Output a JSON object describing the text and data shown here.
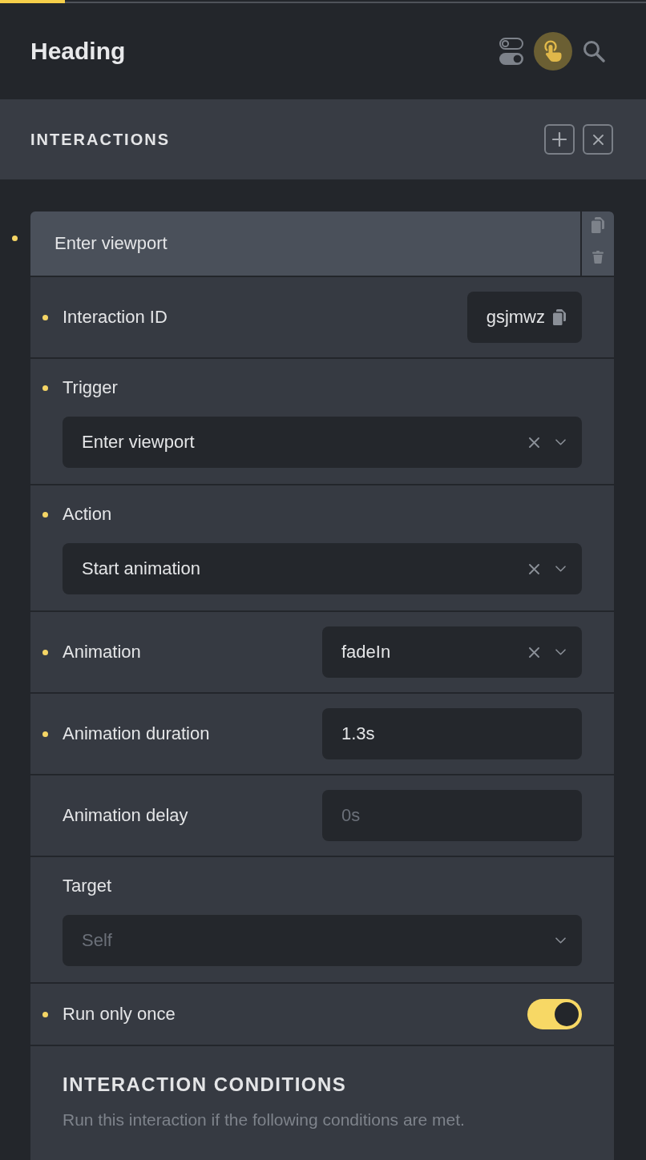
{
  "progress": {
    "level": 0.1
  },
  "header": {
    "title": "Heading",
    "tools": [
      {
        "kind": "toggles",
        "selected": false
      },
      {
        "kind": "pointer",
        "selected": true
      },
      {
        "kind": "search",
        "selected": false
      }
    ]
  },
  "interactions_bar": {
    "title": "INTERACTIONS",
    "buttons": [
      {
        "kind": "add"
      },
      {
        "kind": "close"
      }
    ]
  },
  "interaction": {
    "title": "Enter viewport",
    "modified": true,
    "actions": [
      {
        "kind": "copy"
      },
      {
        "kind": "delete"
      }
    ],
    "fields": [
      {
        "kind": "id",
        "label": "Interaction ID",
        "modified": true,
        "value": "gsjmwz"
      },
      {
        "kind": "dropdown",
        "label": "Trigger",
        "modified": true,
        "stacked": true,
        "value": "Enter viewport"
      },
      {
        "kind": "dropdown",
        "label": "Action",
        "modified": true,
        "stacked": true,
        "value": "Start animation"
      },
      {
        "kind": "dropdown",
        "label": "Animation",
        "modified": true,
        "stacked": false,
        "value": "fadeIn"
      },
      {
        "kind": "text",
        "label": "Animation duration",
        "modified": true,
        "value": "1.3s"
      },
      {
        "kind": "text",
        "label": "Animation delay",
        "modified": false,
        "placeholder": "0s"
      },
      {
        "kind": "dropdown",
        "label": "Target",
        "modified": false,
        "stacked": true,
        "placeholder": "Self"
      },
      {
        "kind": "toggle",
        "label": "Run only once",
        "modified": true,
        "on": true
      }
    ],
    "conditions": {
      "title": "INTERACTION CONDITIONS",
      "description": "Run this interaction if the following conditions are met."
    }
  }
}
